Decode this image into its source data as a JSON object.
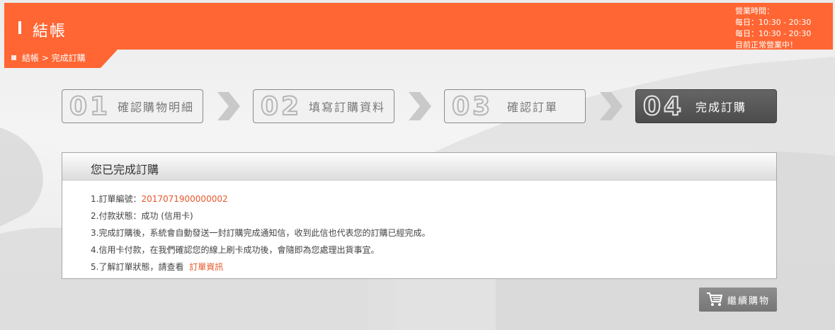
{
  "header": {
    "title": "結帳",
    "hours": [
      "營業時間：",
      "每日：10:30 - 20:30",
      "每日：10:30 - 20:30",
      "目前正常營業中！"
    ]
  },
  "breadcrumb": {
    "text": "結帳 > 完成訂購"
  },
  "steps": [
    {
      "num": "01",
      "label": "確認購物明細"
    },
    {
      "num": "02",
      "label": "填寫訂購資料"
    },
    {
      "num": "03",
      "label": "確認訂單"
    },
    {
      "num": "04",
      "label": "完成訂購"
    }
  ],
  "panel": {
    "title": "您已完成訂購",
    "order_label": "1.訂單編號：",
    "order_number": "2017071900000002",
    "payment_status": "2.付款狀態：成功 (信用卡)",
    "line3": "3.完成訂購後，系統會自動發送一封訂購完成通知信，收到此信也代表您的訂購已經完成。",
    "line4": "4.信用卡付款，在我們確認您的線上刷卡成功後，會隨即為您處理出貨事宜。",
    "line5_prefix": "5.了解訂單狀態，請查看",
    "order_info_link": "訂單資訊"
  },
  "continue_button": {
    "label": "繼續購物"
  },
  "icons": {
    "cart": "shopping-cart-icon",
    "arrow": "chevron-right-icon"
  },
  "colors": {
    "accent": "#ff6633",
    "link": "#e6582a",
    "active_step": "#555555"
  }
}
